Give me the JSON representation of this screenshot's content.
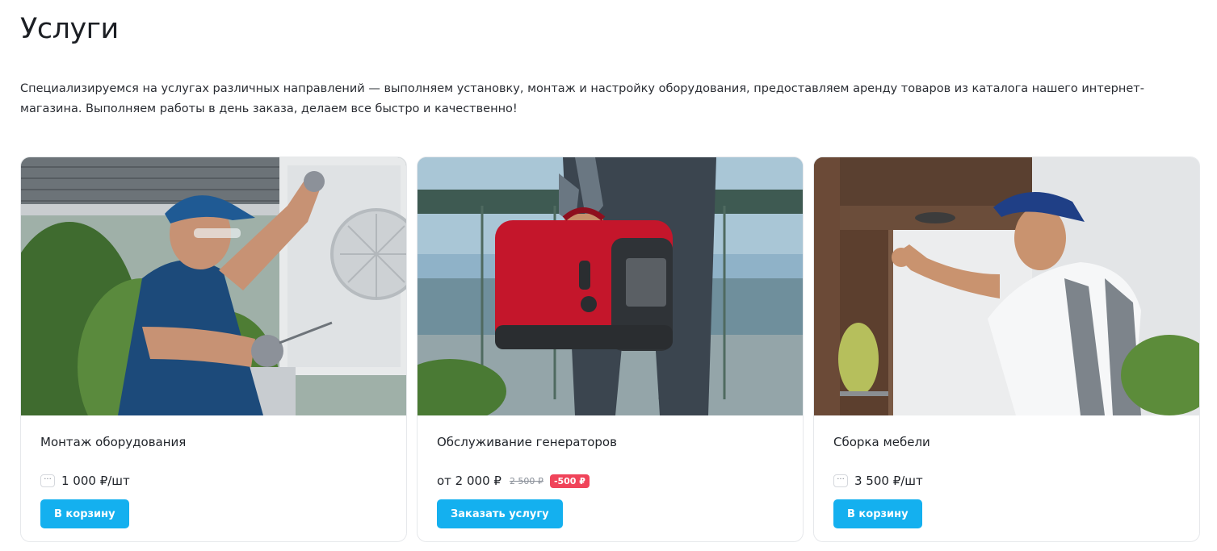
{
  "page": {
    "title": "Услуги",
    "intro": "Специализируемся на услугах различных направлений — выполняем установку, монтаж и настройку оборудования, предоставляем аренду товаров из каталога нашего интернет-магазина. Выполняем работы в день заказа, делаем все быстро и качественно!"
  },
  "colors": {
    "accent": "#14b0ef",
    "discount": "#f0445a"
  },
  "cards": [
    {
      "image": "technician-installing-air-conditioner-photo",
      "name": "Монтаж оборудования",
      "options_icon": "···",
      "price": "1 000 ₽/шт",
      "button": "В корзину"
    },
    {
      "image": "man-carrying-red-generator-photo",
      "name": "Обслуживание генераторов",
      "price": "от 2 000 ₽",
      "old_price": "2 500 ₽",
      "discount": "-500 ₽",
      "button": "Заказать услугу"
    },
    {
      "image": "worker-assembling-kitchen-cabinet-photo",
      "name": "Сборка мебели",
      "options_icon": "···",
      "price": "3 500 ₽/шт",
      "button": "В корзину"
    }
  ]
}
